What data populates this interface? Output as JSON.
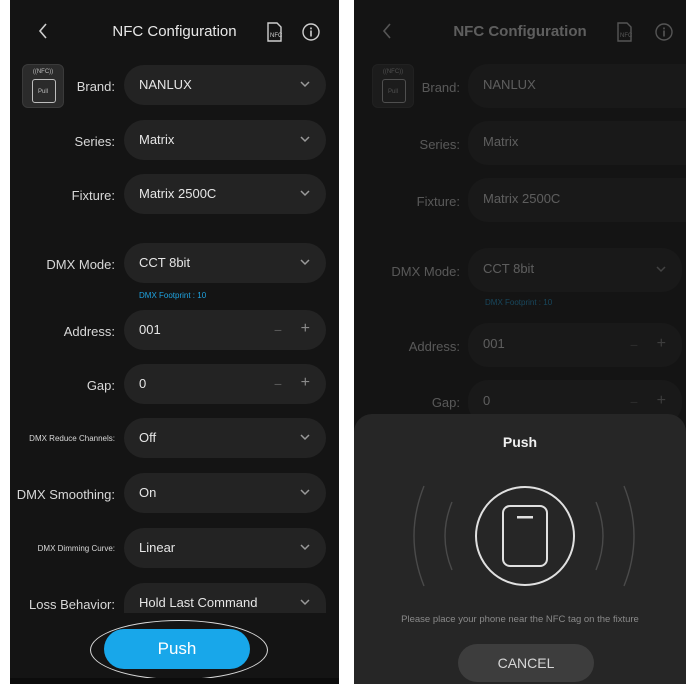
{
  "header": {
    "title": "NFC Configuration"
  },
  "nfc_badge": {
    "top": "((NFC))",
    "bottom": "Pull"
  },
  "rows": {
    "brand": {
      "label": "Brand:",
      "value": "NANLUX"
    },
    "series": {
      "label": "Series:",
      "value": "Matrix"
    },
    "fixture": {
      "label": "Fixture:",
      "value": "Matrix 2500C"
    },
    "dmx_mode": {
      "label": "DMX Mode:",
      "value": "CCT 8bit",
      "footprint": "DMX Footprint : 10"
    },
    "address": {
      "label": "Address:",
      "value": "001"
    },
    "gap": {
      "label": "Gap:",
      "value": "0"
    },
    "reduce_channels": {
      "label": "DMX Reduce Channels:",
      "value": "Off"
    },
    "smoothing": {
      "label": "DMX Smoothing:",
      "value": "On"
    },
    "dimming_curve": {
      "label": "DMX Dimming Curve:",
      "value": "Linear"
    },
    "loss_behavior": {
      "label": "Loss Behavior:",
      "value": "Hold Last Command"
    }
  },
  "push_button": "Push",
  "sheet": {
    "title": "Push",
    "message": "Please place your phone near the NFC tag on the fixture",
    "cancel": "CANCEL"
  },
  "colors": {
    "accent": "#18a7ea",
    "background": "#141414",
    "field": "#232323"
  },
  "icons": [
    "back-chevron-icon",
    "nfc-tag-icon",
    "info-icon",
    "chevron-down-icon",
    "minus-icon",
    "plus-icon",
    "phone-icon"
  ]
}
